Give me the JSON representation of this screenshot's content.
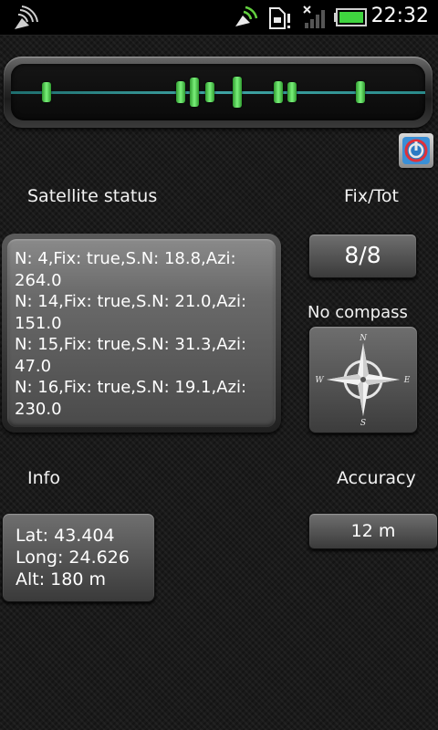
{
  "status_bar": {
    "time": "22:32",
    "icons": [
      "satellite-dish-icon",
      "gps-signal-icon",
      "sd-card-warning-icon",
      "no-signal-icon",
      "battery-icon"
    ],
    "battery_color": "#3fd43f"
  },
  "signal_meter": {
    "bars": [
      {
        "level": 0.5
      },
      {
        "level": 0.6
      },
      {
        "level": 0.9
      },
      {
        "level": 0.5
      },
      {
        "level": 1.0
      },
      {
        "level": 0.6
      },
      {
        "level": 0.5
      },
      {
        "level": 0.6
      }
    ]
  },
  "labels": {
    "satellite_status": "Satellite status",
    "fix_tot": "Fix/Tot",
    "no_compass": "No compass",
    "info": "Info",
    "accuracy": "Accuracy"
  },
  "satellites": [
    "N: 4,Fix: true,S.N: 18.8,Azi:",
    "264.0",
    "N: 14,Fix: true,S.N: 21.0,Azi:",
    "151.0",
    "N: 15,Fix: true,S.N: 31.3,Azi:",
    "47.0",
    "N: 16,Fix: true,S.N: 19.1,Azi:",
    "230.0"
  ],
  "fix_tot_value": "8/8",
  "accuracy_value": "12 m",
  "info": {
    "lat": "Lat: 43.404",
    "long": "Long: 24.626",
    "alt": "Alt: 180 m"
  },
  "compass_letters": {
    "n": "N",
    "e": "E",
    "s": "S",
    "w": "W"
  },
  "colors": {
    "accent_green": "#5ee05e",
    "line_teal": "#3fa3a3",
    "power_red": "#e0303a"
  }
}
